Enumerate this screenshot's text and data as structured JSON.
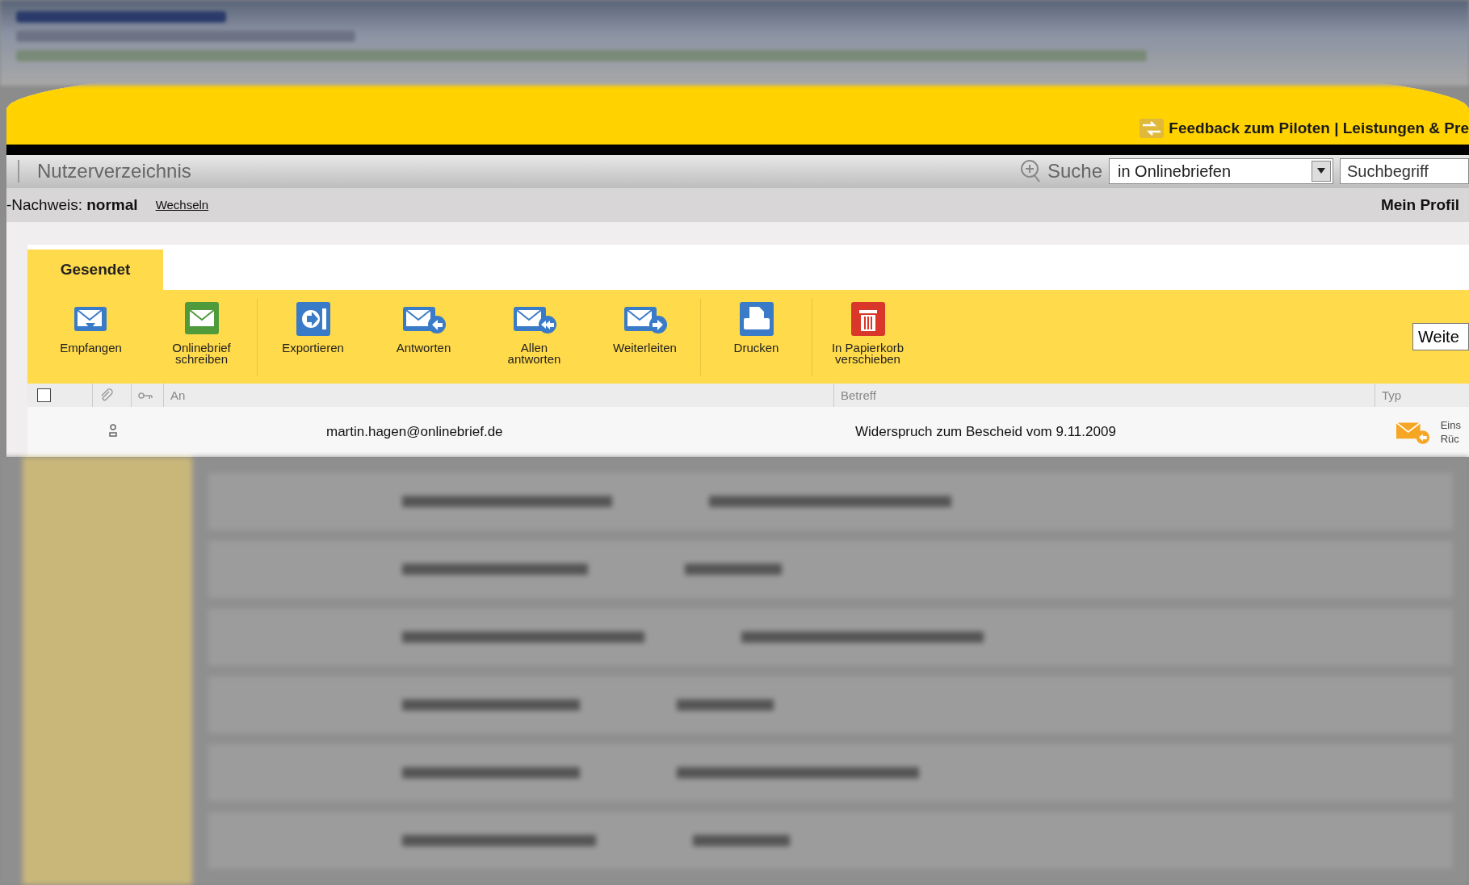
{
  "banner": {
    "feedback_link": "Feedback zum Piloten | Leistungen & Pre"
  },
  "nav": {
    "title": "Nutzerverzeichnis",
    "search_label": "Suche",
    "search_scope": "in Onlinebriefen",
    "search_field": {
      "placeholder": "Suchbegriff"
    }
  },
  "status": {
    "label": "-Nachweis:",
    "value": "normal",
    "switch_link": "Wechseln",
    "profile_link": "Mein Profil"
  },
  "tabs": [
    {
      "label": "Gesendet",
      "selected": true
    }
  ],
  "toolbar": [
    {
      "kind": "receive",
      "label": "Empfangen"
    },
    {
      "kind": "compose",
      "label": "Onlinebrief schreiben"
    },
    {
      "kind": "export",
      "label": "Exportieren"
    },
    {
      "kind": "reply",
      "label": "Antworten"
    },
    {
      "kind": "replyall",
      "label": "Allen antworten"
    },
    {
      "kind": "forward",
      "label": "Weiterleiten"
    },
    {
      "kind": "print",
      "label": "Drucken"
    },
    {
      "kind": "trash",
      "label": "In Papierkorb verschieben"
    }
  ],
  "toolbar_select": "Weite",
  "table": {
    "select_all_checked": false,
    "columns": [
      "An",
      "Betreff",
      "Typ"
    ],
    "rows": [
      {
        "to": "martin.hagen@onlinebrief.de",
        "subject": "Widerspruch zum Bescheid vom 9.11.2009",
        "type_lines": [
          "Eins",
          "Rüc"
        ]
      }
    ]
  }
}
